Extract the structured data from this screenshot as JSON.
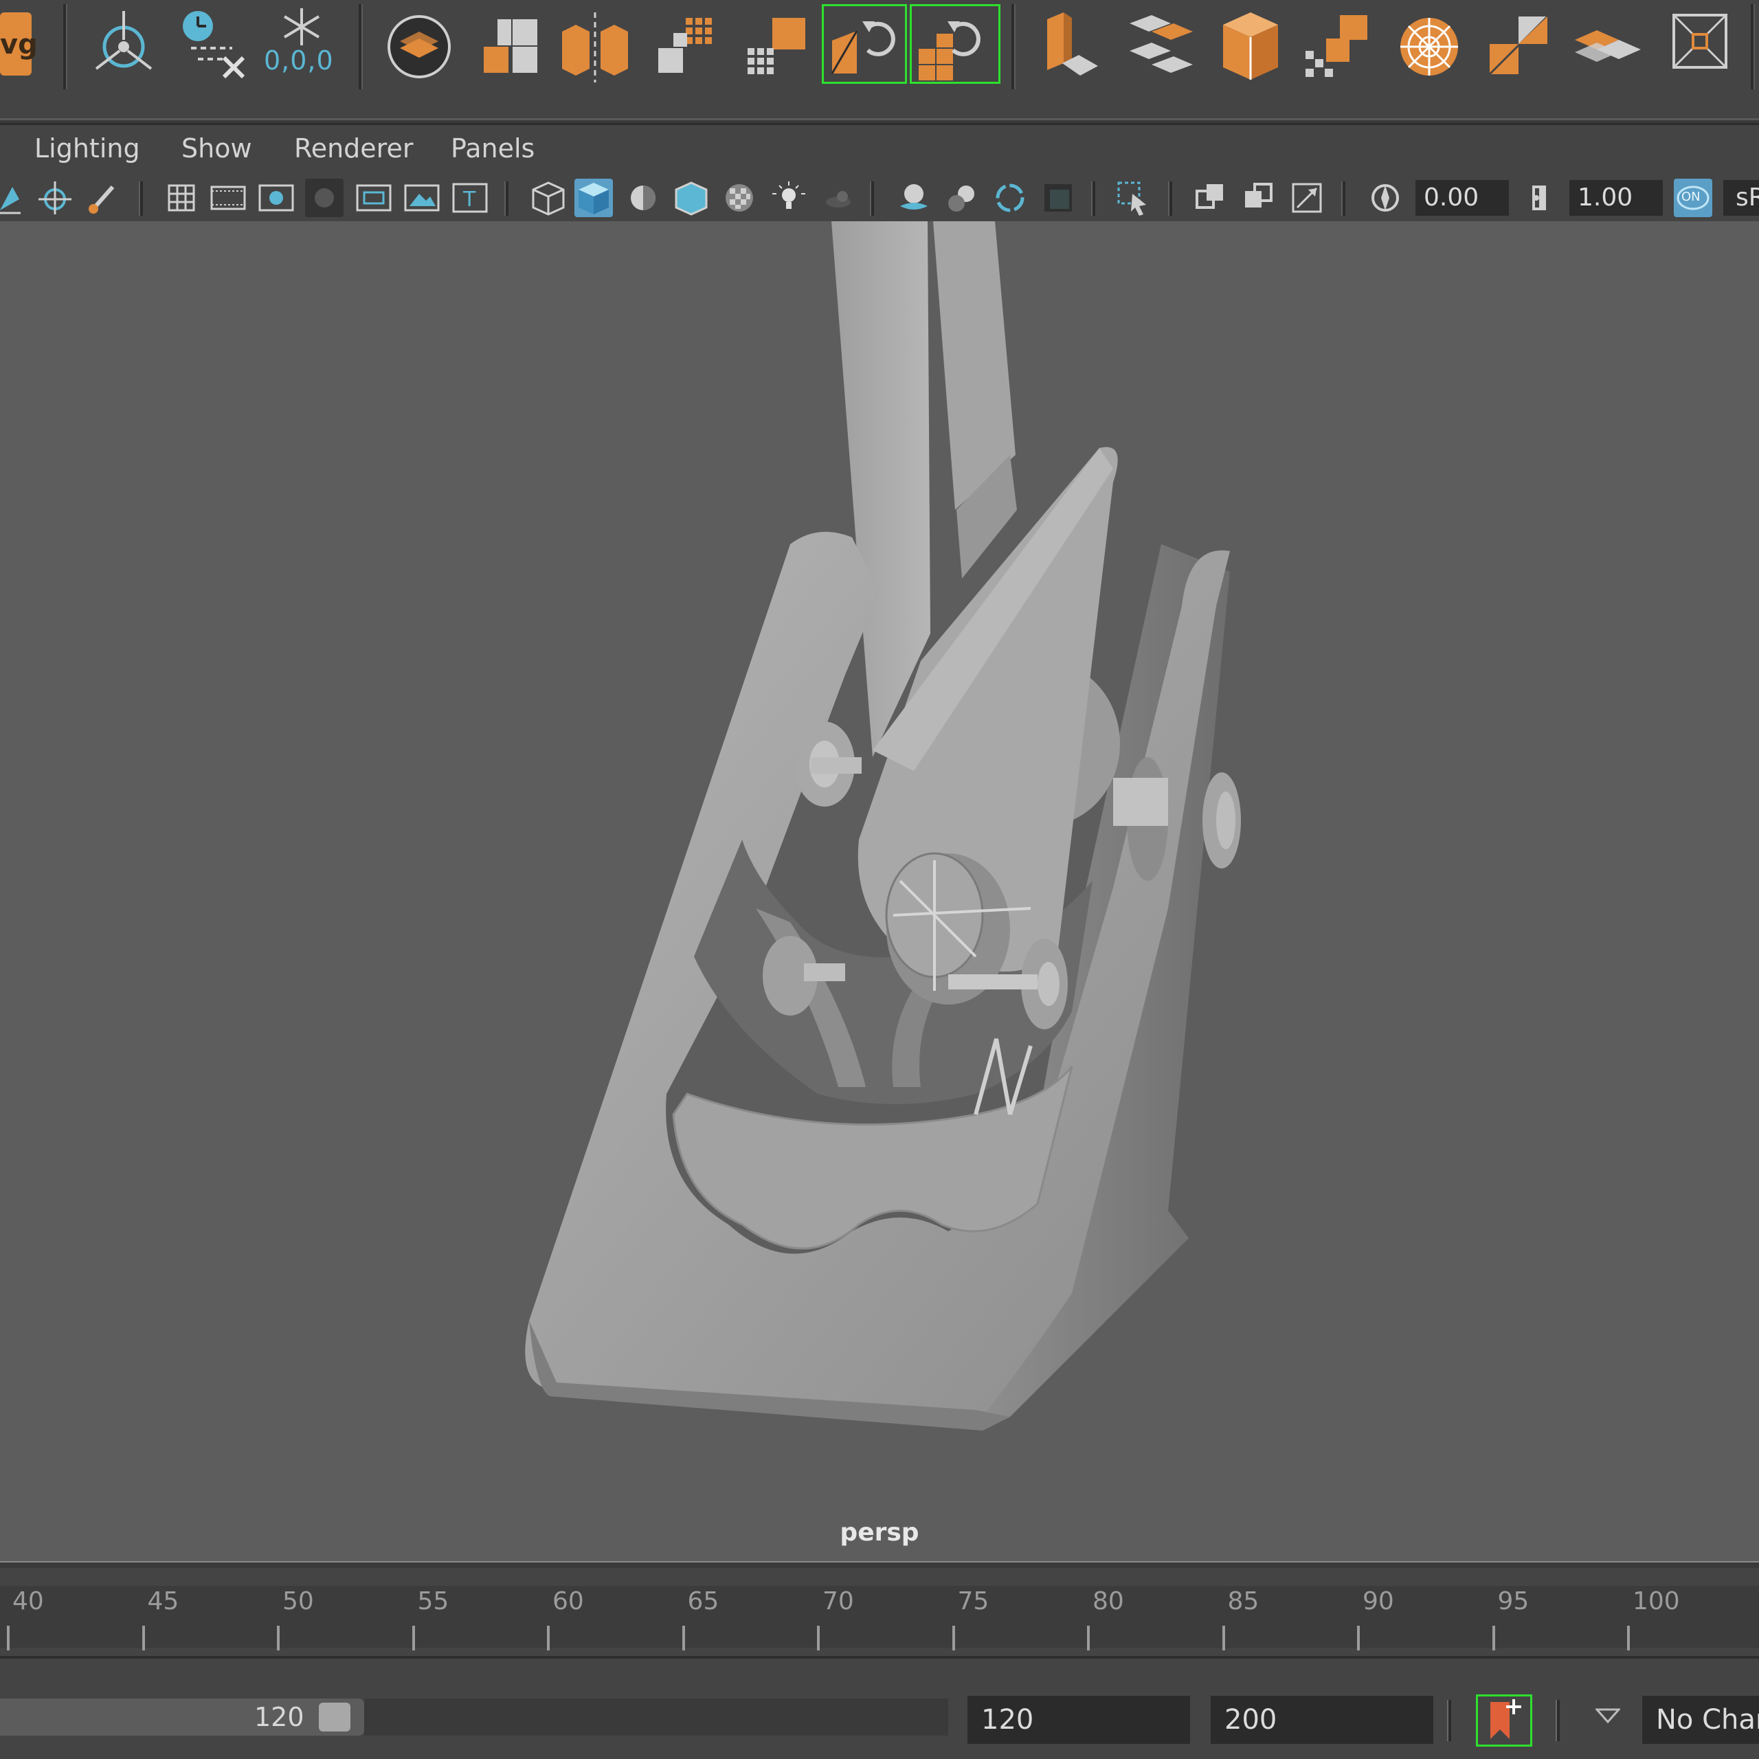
{
  "shelf": {
    "svg_label": "vg",
    "origin_label": "0,0,0",
    "buttons": [
      "svg-to-poly-icon",
      "pivot-icon",
      "delete-history-icon",
      "freeze-transforms-icon",
      "make-live-icon",
      "uv-layout-icon",
      "cut-uv-icon",
      "unfold-icon",
      "layout-grid-icon",
      "split-uv-icon",
      "rotate-uv-cw-icon",
      "rotate-uv-ccw-icon",
      "planar-map-icon",
      "flatten-icon",
      "cube-map-icon",
      "sew-uv-icon",
      "sphere-map-icon",
      "stack-icon",
      "stack-shells-icon",
      "frame-icon"
    ]
  },
  "menu": {
    "lighting": "Lighting",
    "show": "Show",
    "renderer": "Renderer",
    "panels": "Panels"
  },
  "toolbar": {
    "exposure": "0.00",
    "gamma": "1.00",
    "color_space_partial": "sR",
    "on_label": "ON"
  },
  "viewport": {
    "camera_label": "persp"
  },
  "timeslider": {
    "ticks": [
      "40",
      "45",
      "50",
      "55",
      "60",
      "65",
      "70",
      "75",
      "80",
      "85",
      "90",
      "95",
      "100"
    ]
  },
  "range": {
    "playback_end": "120",
    "anim_end": "120",
    "max_end": "200",
    "character_set": "No Character Set"
  },
  "colors": {
    "accent_orange": "#e08a3c",
    "accent_cyan": "#5bb7d3",
    "highlight_green": "#2ee02e",
    "viewport_bg": "#5d5d5d"
  }
}
